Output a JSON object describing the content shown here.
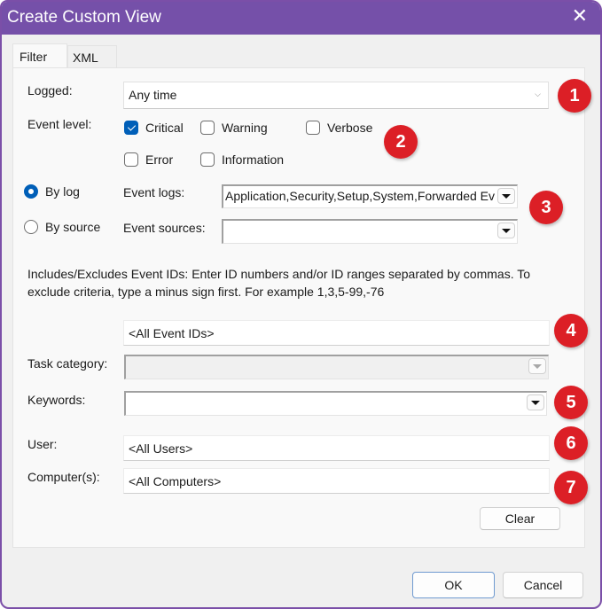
{
  "window": {
    "title": "Create Custom View",
    "close_icon": "close-icon"
  },
  "tabs": [
    {
      "label": "Filter",
      "active": true
    },
    {
      "label": "XML",
      "active": false
    }
  ],
  "filter": {
    "logged": {
      "label": "Logged:",
      "value": "Any time"
    },
    "event_level": {
      "label": "Event level:",
      "options": [
        {
          "label": "Critical",
          "checked": true
        },
        {
          "label": "Warning",
          "checked": false
        },
        {
          "label": "Verbose",
          "checked": false
        },
        {
          "label": "Error",
          "checked": false
        },
        {
          "label": "Information",
          "checked": false
        }
      ]
    },
    "by_log": {
      "label": "By log",
      "selected": true
    },
    "by_source": {
      "label": "By source",
      "selected": false
    },
    "event_logs": {
      "label": "Event logs:",
      "value": "Application,Security,Setup,System,Forwarded Ev"
    },
    "event_sources": {
      "label": "Event sources:",
      "value": ""
    },
    "event_ids_description": "Includes/Excludes Event IDs: Enter ID numbers and/or ID ranges separated by commas. To exclude criteria, type a minus sign first. For example 1,3,5-99,-76",
    "event_ids": {
      "value": "<All Event IDs>"
    },
    "task_category": {
      "label": "Task category:",
      "value": ""
    },
    "keywords": {
      "label": "Keywords:",
      "value": ""
    },
    "user": {
      "label": "User:",
      "value": "<All Users>"
    },
    "computers": {
      "label": "Computer(s):",
      "value": "<All Computers>"
    },
    "clear_label": "Clear"
  },
  "annotations": [
    "1",
    "2",
    "3",
    "4",
    "5",
    "6",
    "7"
  ],
  "colors": {
    "titlebar": "#7550a9",
    "badge": "#dc1f26",
    "accent": "#005fb8"
  },
  "footer": {
    "ok_label": "OK",
    "cancel_label": "Cancel"
  }
}
